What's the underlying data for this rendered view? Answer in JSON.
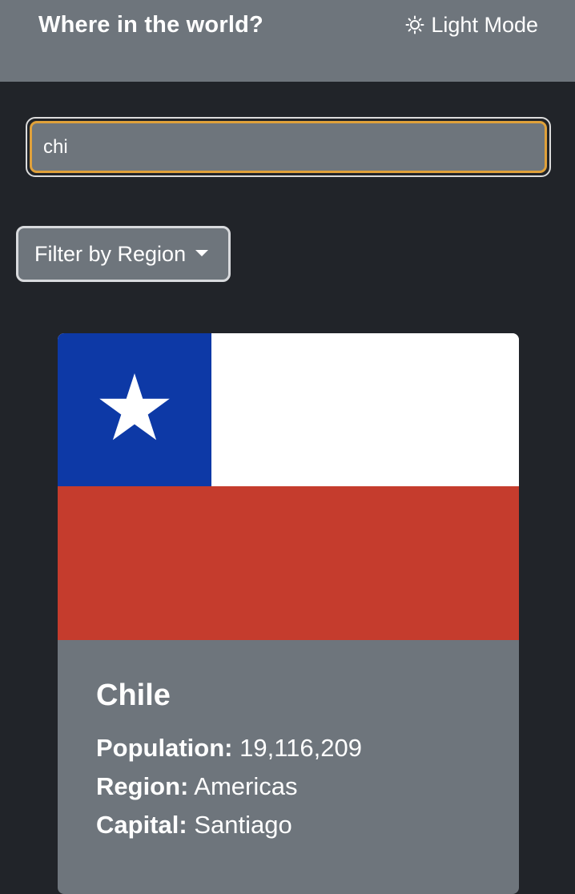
{
  "header": {
    "title": "Where in the world?",
    "mode_toggle_label": "Light Mode",
    "mode_icon": "sun-icon"
  },
  "search": {
    "value": "chi",
    "placeholder": ""
  },
  "filter": {
    "label": "Filter by Region",
    "icon": "caret-down-icon"
  },
  "countries": [
    {
      "name": "Chile",
      "population_label": "Population:",
      "population": "19,116,209",
      "region_label": "Region:",
      "region": "Americas",
      "capital_label": "Capital:",
      "capital": "Santiago",
      "flag_colors": {
        "blue": "#0d39a6",
        "white": "#ffffff",
        "red": "#c53c2d"
      }
    }
  ],
  "colors": {
    "background": "#212429",
    "header": "#6e757c",
    "focus_ring": "#e0a13a"
  }
}
